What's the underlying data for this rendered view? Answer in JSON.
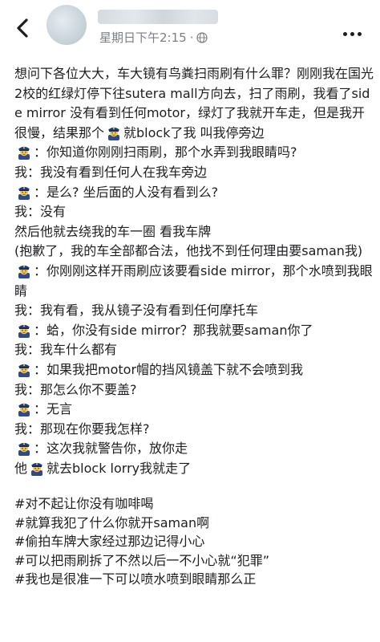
{
  "header": {
    "time": "星期日下午2:15",
    "dot": "·",
    "icons": {
      "back": "chevron-left-icon",
      "privacy": "globe-icon",
      "more": "more-dots-icon"
    }
  },
  "post": {
    "intro": "想问下各位大大，车大镜有鸟粪扫雨刷有什么罪？刚刚我在国光2校的红绿灯停下往sutera mall方向去，扫了雨刷，我看了side mirror 没有看到任何motor，绿灯了我就开车走，但是我开很慢，结果那个",
    "intro_end": "就block了我 叫我停旁边",
    "l1": "：你知道你刚刚扫雨刷，那个水弄到我眼睛吗?",
    "l2": "我：我没有看到任何人在我车旁边",
    "l3": "：是么? 坐后面的人没有看到么?",
    "l4": "我：没有",
    "l5": "然后他就去绕我的车一圈 看我车牌",
    "l6": "(抱歉了，我的车全部都合法，他找不到任何理由要saman我)",
    "l7": "：你刚刚这样开雨刷应该要看side mirror，那个水喷到我眼睛",
    "l8": "我：我有看，我从镜子没有看到任何摩托车",
    "l9": "：蛤，你没有side mirror？那我就要saman你了",
    "l10": "我：我车什么都有",
    "l11": "：如果我把motor帽的挡风镜盖下就不会喷到我",
    "l12": "我：那怎么你不要盖?",
    "l13": "：无言",
    "l14": "我：那现在你要我怎样?",
    "l15": "：这次我就警告你，放你走",
    "l16a": "他",
    "l16b": "就去block lorry我就走了",
    "tags": [
      "#对不起让你没有咖啡喝",
      "#就算我犯了什么你就开saman啊",
      "#偷拍车牌大家经过那边记得小心",
      "#可以把雨刷拆了不然以后一不小心就“犯罪”",
      "#我也是很准一下可以喷水喷到眼睛那么正"
    ]
  },
  "emoji": {
    "police": "police-officer-emoji"
  }
}
